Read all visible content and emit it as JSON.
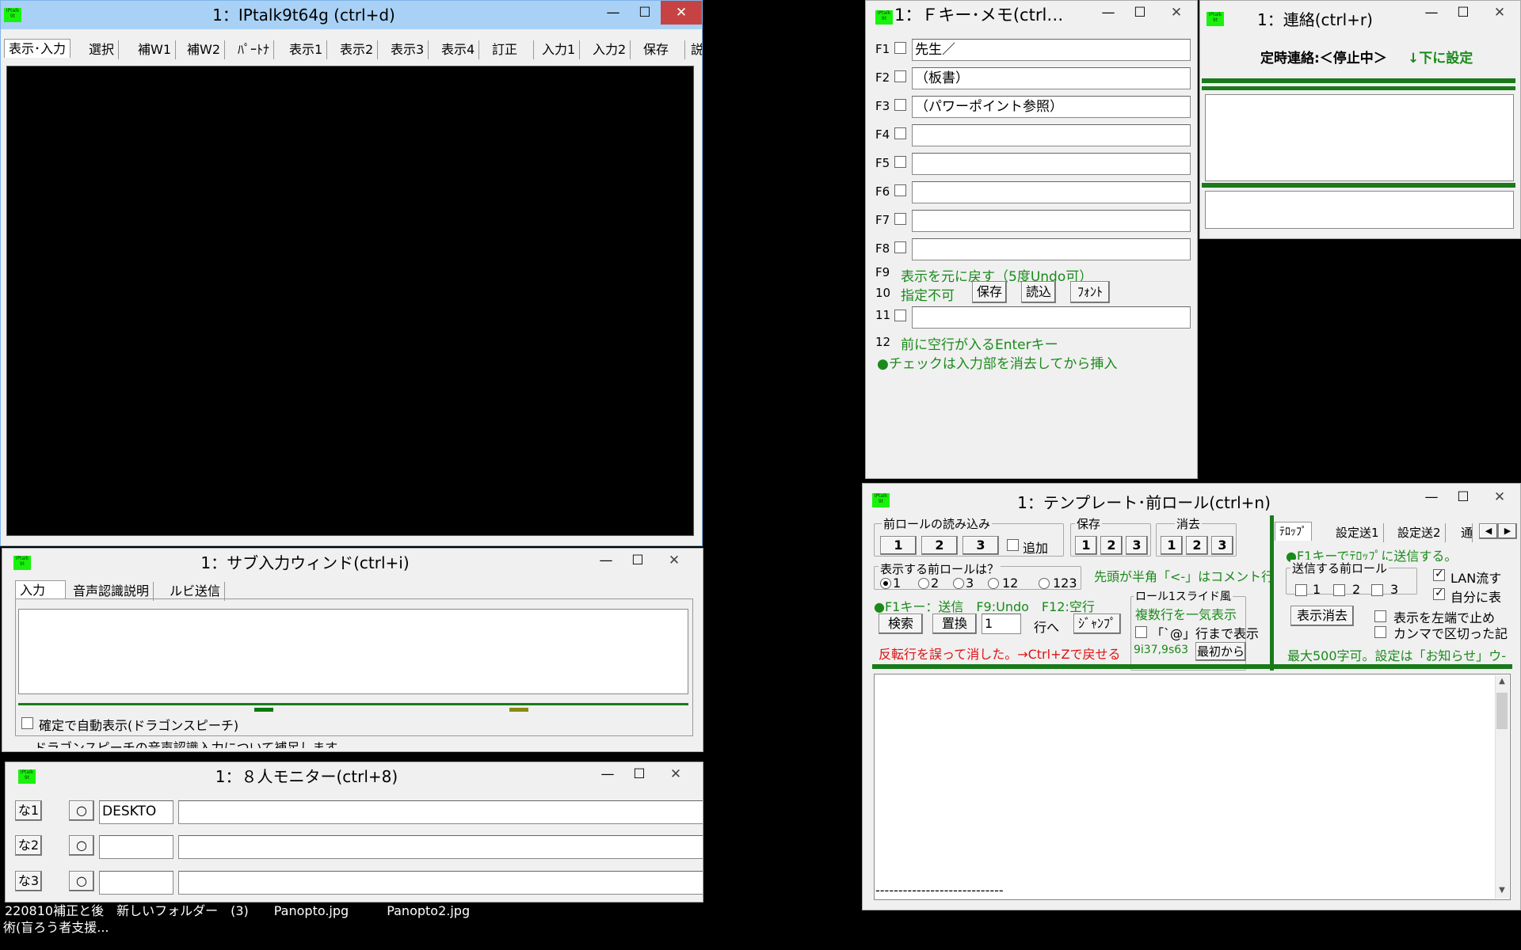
{
  "main_window": {
    "title": "1：IPtalk9t64g (ctrl+d)",
    "tabs": [
      "表示･入力",
      "選択",
      "補W1",
      "補W2",
      "ﾊﾟｰﾄﾅ",
      "表示1",
      "表示2",
      "表示3",
      "表示4",
      "訂正",
      "入力1",
      "入力2",
      "保存",
      "説明"
    ]
  },
  "fkey_window": {
    "title": "1：Ｆキー･メモ(ctrl…",
    "keys": [
      {
        "label": "F1",
        "value": "先生／"
      },
      {
        "label": "F2",
        "value": "（板書）"
      },
      {
        "label": "F3",
        "value": "（パワーポイント参照）"
      },
      {
        "label": "F4",
        "value": ""
      },
      {
        "label": "F5",
        "value": ""
      },
      {
        "label": "F6",
        "value": ""
      },
      {
        "label": "F7",
        "value": ""
      },
      {
        "label": "F8",
        "value": ""
      }
    ],
    "f9_label": "F9",
    "f9_text": "表示を元に戻す（5度Undo可）",
    "f10_label": "10",
    "f10_text": "指定不可",
    "save_button": "保存",
    "load_button": "読込",
    "font_button": "ﾌｫﾝﾄ",
    "f11_label": "11",
    "f11_value": "",
    "f12_label": "12",
    "f12_text": "前に空行が入るEnterキー",
    "note": "●チェックは入力部を消去してから挿入"
  },
  "contact_window": {
    "title": "1：連絡(ctrl+r)",
    "status_text": "定時連絡:＜停止中＞",
    "set_below": "↓下に設定"
  },
  "sub_input_window": {
    "title": "1：サブ入力ウィンド(ctrl+i)",
    "tabs": [
      "入力",
      "音声認識説明",
      "ルビ送信"
    ],
    "auto_display_label": "確定で自動表示(ドラゴンスピーチ)",
    "cut_line": "ドラゴンスピーチの音声認識入力について補足します"
  },
  "monitor_window": {
    "title": "1：８人モニター(ctrl+8)",
    "rows": [
      {
        "label": "な1",
        "circle": "○",
        "name": "DESKTO",
        "text": ""
      },
      {
        "label": "な2",
        "circle": "○",
        "name": "",
        "text": ""
      },
      {
        "label": "な3",
        "circle": "○",
        "name": "",
        "text": ""
      }
    ]
  },
  "template_window": {
    "title": "1：テンプレート･前ロール(ctrl+n)",
    "preroll_group": "前ロールの読み込み",
    "preroll_buttons": [
      "1",
      "2",
      "3"
    ],
    "add_label": "追加",
    "save_group": "保存",
    "save_buttons": [
      "1",
      "2",
      "3"
    ],
    "clear_group": "消去",
    "clear_buttons": [
      "1",
      "2",
      "3"
    ],
    "display_group": "表示する前ロールは？",
    "display_options": [
      "1",
      "2",
      "3",
      "12",
      "123"
    ],
    "comment_note": "先頭が半角「<-」はコメント行",
    "f1_hint": "●F1キー：送信　F9:Undo　F12:空行",
    "search_button": "検索",
    "replace_button": "置換",
    "line_value": "1",
    "line_label": "行へ",
    "jump_button": "ｼﾞｬﾝﾌﾟ",
    "slide_group": "ロール1スライド風",
    "multi_line": "複数行を一気表示",
    "at_line_label": "「`@」行まで表示",
    "position_text": "9i37,9s63",
    "from_start_button": "最初から",
    "undo_warning": "反転行を誤って消した。→Ctrl+Zで戻せる",
    "right_tabs": [
      "ﾃﾛｯﾌﾟ",
      "設定送1",
      "設定送2",
      "通"
    ],
    "telop_hint": "●F1キーでﾃﾛｯﾌﾟに送信する。",
    "send_group": "送信する前ロール",
    "send_options": [
      "1",
      "2",
      "3"
    ],
    "lan_label": "LAN流す",
    "self_label": "自分に表",
    "clear_display_button": "表示消去",
    "left_stop_label": "表示を左端で止め",
    "comma_label": "カンマで区切った記",
    "max_note": "最大500字可。設定は「お知らせ」ウ-",
    "editor_text": "----------------------------"
  },
  "desktop_text": [
    "220810補正と後　新しいフォルダー　(3)　　Panopto.jpg　　　Panopto2.jpg",
    "術(盲ろう者支援..."
  ]
}
